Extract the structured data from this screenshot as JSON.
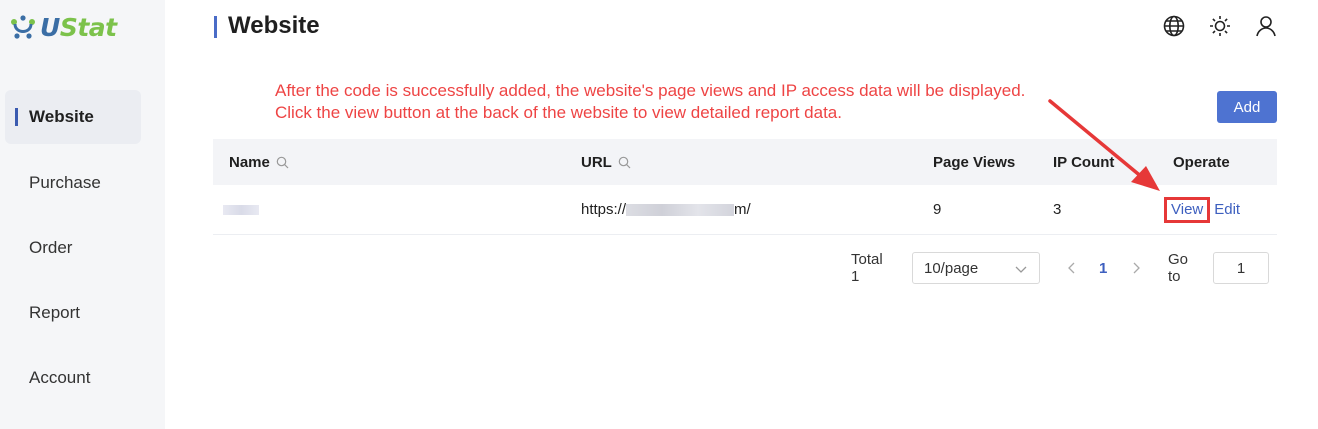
{
  "brand": {
    "logo_u": "U",
    "logo_rest": "Stat"
  },
  "sidebar": {
    "items": [
      {
        "label": "Website",
        "active": true
      },
      {
        "label": "Purchase"
      },
      {
        "label": "Order"
      },
      {
        "label": "Report"
      },
      {
        "label": "Account"
      }
    ]
  },
  "header": {
    "title": "Website",
    "icons": [
      "globe-icon",
      "sun-icon",
      "user-icon"
    ]
  },
  "notice": {
    "line1": "After the code is successfully added, the website's page views and IP access data will be displayed.",
    "line2": "Click the view button at the back of the website to view detailed report data."
  },
  "toolbar": {
    "add_label": "Add"
  },
  "table": {
    "columns": {
      "name": "Name",
      "url": "URL",
      "page_views": "Page Views",
      "ip_count": "IP Count",
      "operate": "Operate"
    },
    "rows": [
      {
        "url_prefix": "https://",
        "url_suffix": "m/",
        "page_views": "9",
        "ip_count": "3",
        "view": "View",
        "edit": "Edit"
      }
    ]
  },
  "pagination": {
    "total": "Total 1",
    "page_size": "10/page",
    "current": "1",
    "goto_label": "Go to",
    "goto_value": "1"
  },
  "colors": {
    "accent": "#4e73d1",
    "annotation": "#e63838",
    "sidebar_bg": "#f5f6f8",
    "logo_green": "#7cc24b"
  }
}
